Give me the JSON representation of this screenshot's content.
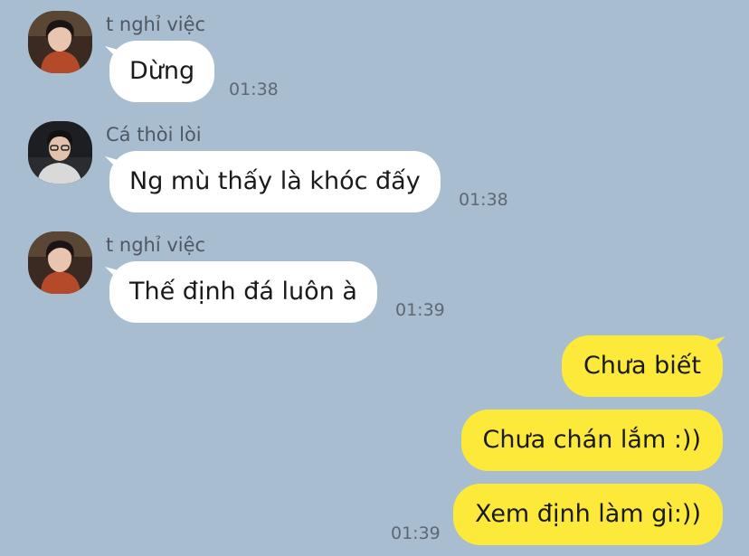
{
  "messages": [
    {
      "sender": "t nghỉ việc",
      "text": "Dừng",
      "time": "01:38"
    },
    {
      "sender": "Cá thòi lòi",
      "text": "Ng mù thấy là khóc đấy",
      "time": "01:38"
    },
    {
      "sender": "t nghỉ việc",
      "text": "Thế định đá luôn à",
      "time": "01:39"
    },
    {
      "text": "Chưa biết"
    },
    {
      "text": "Chưa chán lắm :))"
    },
    {
      "text": "Xem định làm gì:))",
      "time": "01:39"
    }
  ],
  "icons": {
    "avatar_1": "user-avatar-icon",
    "avatar_2": "user-avatar-icon",
    "avatar_3": "user-avatar-icon"
  }
}
